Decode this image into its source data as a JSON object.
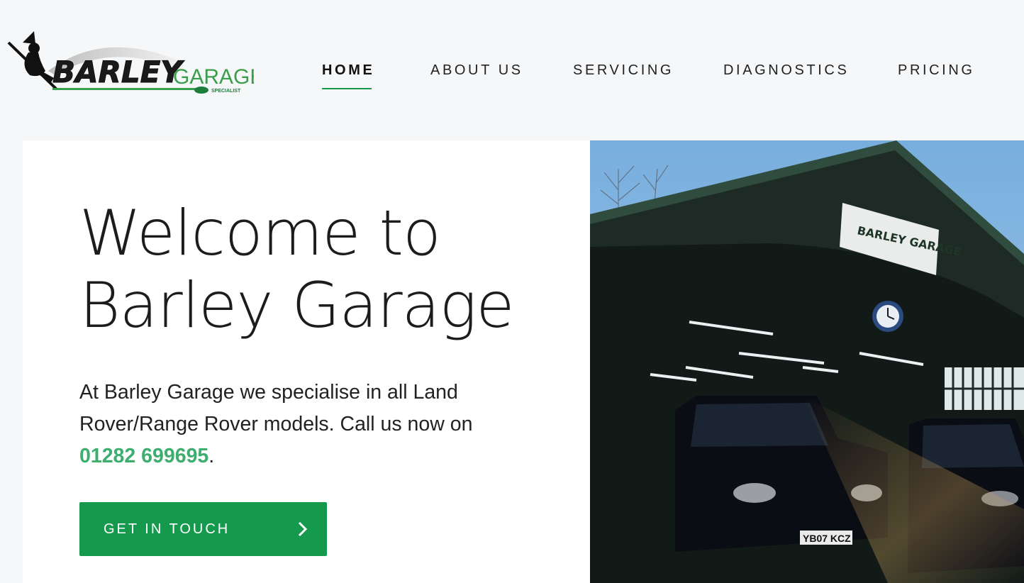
{
  "header": {
    "logo": {
      "brand_word": "BARLEY",
      "brand_suffix": "GARAGE",
      "tagline": "SPECIALIST"
    },
    "nav": [
      {
        "label": "HOME",
        "active": true
      },
      {
        "label": "ABOUT US",
        "active": false
      },
      {
        "label": "SERVICING",
        "active": false
      },
      {
        "label": "DIAGNOSTICS",
        "active": false
      },
      {
        "label": "PRICING",
        "active": false
      }
    ]
  },
  "hero": {
    "title_line1": "Welcome to",
    "title_line2": "Barley Garage",
    "description_prefix": "At Barley Garage we specialise in all Land Rover/Range Rover models. Call us now on ",
    "phone": "01282 699695",
    "description_suffix": ".",
    "cta_label": "GET IN TOUCH",
    "cta_icon": "chevron-right-icon"
  },
  "photo": {
    "sign_text": "BARLEY GARAGE",
    "plate_text": "YB07 KCZ"
  },
  "colors": {
    "accent": "#159a4d",
    "phone": "#3dae6e",
    "background": "#f5f7f9"
  }
}
